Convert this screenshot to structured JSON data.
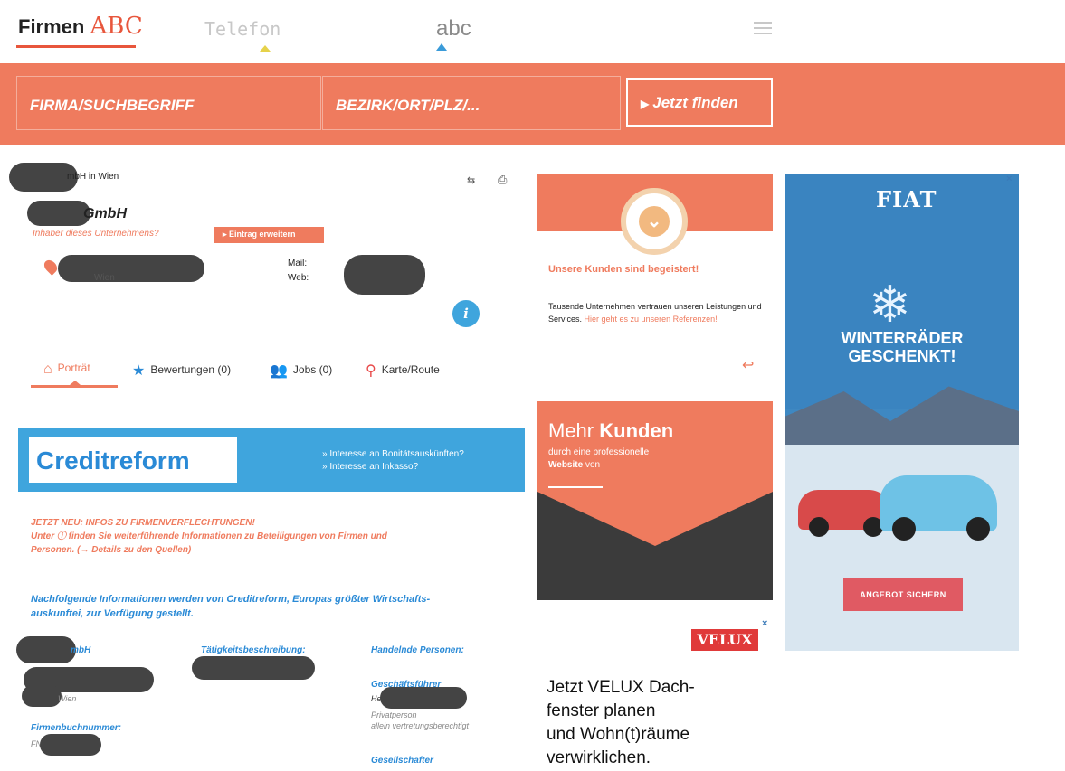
{
  "header": {
    "logo_main": "Firmen",
    "logo_accent": "ABC",
    "nav_telefon": "Telefon",
    "nav_abc": "abc"
  },
  "search": {
    "field1": "FIRMA/SUCHBEGRIFF",
    "field2": "BEZIRK/ORT/PLZ/...",
    "button": "Jetzt finden"
  },
  "company": {
    "subtitle": "mbH in Wien",
    "name": "GmbH",
    "owner_prompt": "Inhaber dieses Unternehmens?",
    "entry_button": "Eintrag erweitern",
    "city": "Wien",
    "mail_label": "Mail:",
    "web_label": "Web:",
    "info": "i"
  },
  "tabs": [
    {
      "label": "Porträt"
    },
    {
      "label": "Bewertungen (0)"
    },
    {
      "label": "Jobs (0)"
    },
    {
      "label": "Karte/Route"
    }
  ],
  "creditreform": {
    "logo": "Creditreform",
    "link1": "» Interesse an Bonitätsauskünften?",
    "link2": "» Interesse an Inkasso?"
  },
  "notes": {
    "new_line1": "JETZT NEU: INFOS ZU FIRMENVERFLECHTUNGEN!",
    "new_line2": "Unter ⓘ finden Sie weiterführende Informationen zu Beteiligungen von Firmen und",
    "new_line3": "Personen. (→ Details zu den Quellen)",
    "source_line1": "Nachfolgende Informationen werden von Creditreform, Europas größter Wirtschafts-",
    "source_line2": "auskunftei, zur Verfügung gestellt."
  },
  "details": {
    "col1_head": "mbH",
    "col1_city": "Wien",
    "firmenbuch_label": "Firmenbuchnummer:",
    "firmenbuch_prefix": "FN",
    "col2_head": "Tätigkeitsbeschreibung:",
    "col3_head": "Handelnde Personen:",
    "gf_label": "Geschäftsführer",
    "gf_name_prefix": "Herr",
    "gf_line1": "Privatperson",
    "gf_line2": "allein vertretungsberechtigt",
    "gesellschafter_label": "Gesellschafter"
  },
  "ads": {
    "box1_heading": "Unsere Kunden sind begeistert!",
    "box1_text": "Tausende Unternehmen vertrauen unseren Leistungen und Services.",
    "box1_link": "Hier geht es zu unseren Referenzen!",
    "box2_heading_light": "Mehr",
    "box2_heading_bold": "Kunden",
    "box2_line1": "durch eine professionelle",
    "box2_line2_bold": "Website",
    "box2_line2_rest": "von",
    "velux_logo": "VELUX",
    "velux_text_line1": "Jetzt VELUX Dach-",
    "velux_text_line2": "fenster planen",
    "velux_text_line3": "und Wohn(t)räume",
    "velux_text_line4": "verwirklichen.",
    "fiat_logo": "FIAT",
    "fiat_heading_line1": "WINTERRÄDER",
    "fiat_heading_line2": "GESCHENKT!",
    "fiat_button": "ANGEBOT SICHERN",
    "close": "×"
  }
}
